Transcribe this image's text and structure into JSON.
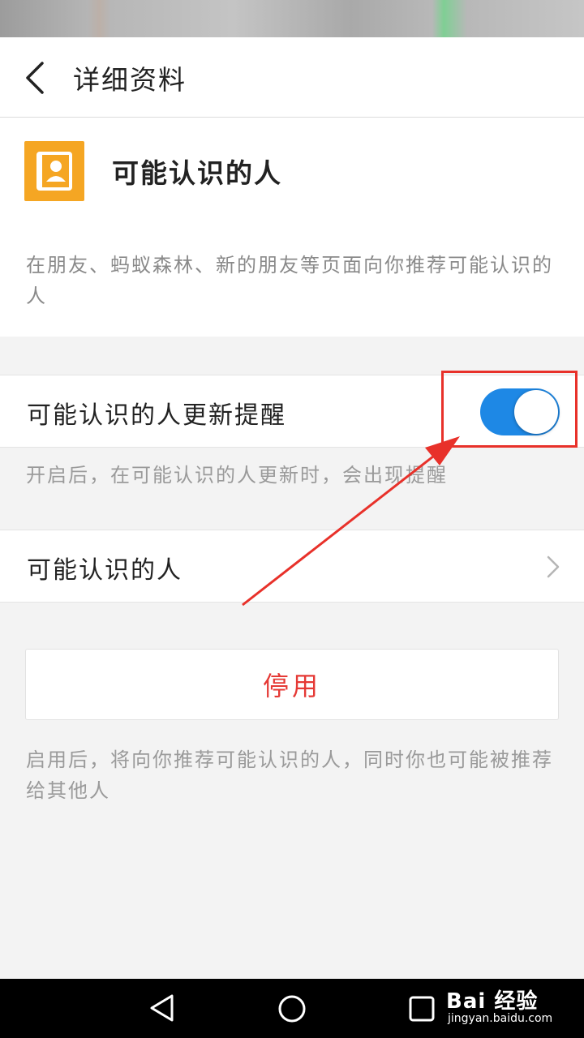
{
  "header": {
    "title": "详细资料",
    "back_icon": "chevron-left-icon"
  },
  "app": {
    "icon": "contact-card-icon",
    "icon_color": "#f5a623",
    "name": "可能认识的人",
    "description": "在朋友、蚂蚁森林、新的朋友等页面向你推荐可能认识的人"
  },
  "settings": {
    "update_reminder": {
      "label": "可能认识的人更新提醒",
      "enabled": true,
      "toggle_color": "#1e88e5",
      "note": "开启后，在可能认识的人更新时，会出现提醒"
    },
    "people_link": {
      "label": "可能认识的人",
      "icon": "chevron-right-icon"
    }
  },
  "disable_button": {
    "label": "停用",
    "color": "#e53935",
    "note": "启用后，将向你推荐可能认识的人，同时你也可能被推荐给其他人"
  },
  "annotation": {
    "color": "#e8312a"
  },
  "navbar": {
    "back_icon": "triangle-back-icon",
    "home_icon": "circle-home-icon",
    "recents_icon": "square-recents-icon"
  },
  "watermark": {
    "brand": "Bai 经验",
    "url": "jingyan.baidu.com"
  }
}
